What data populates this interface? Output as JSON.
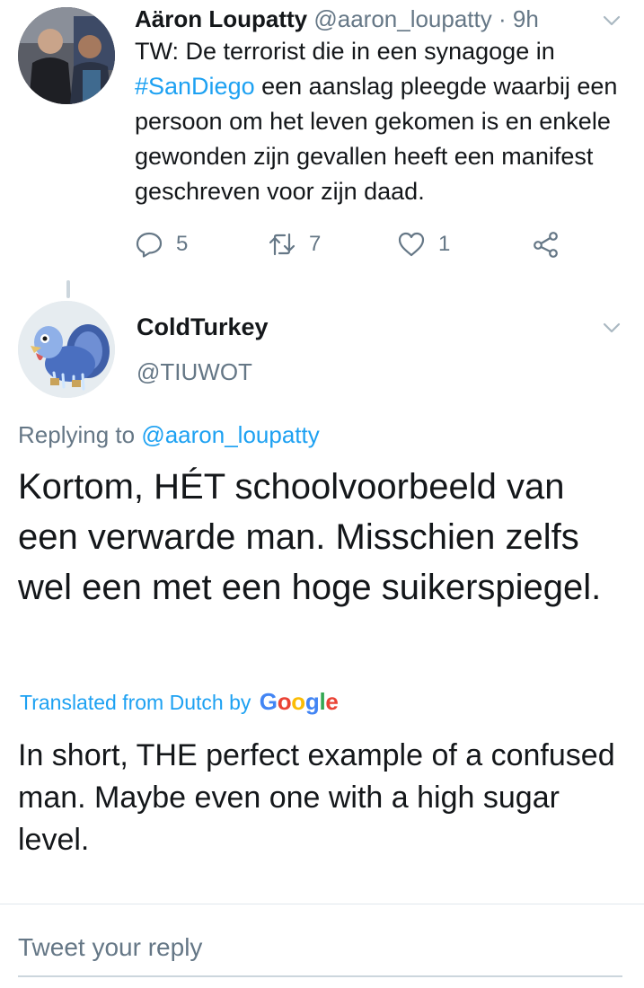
{
  "tweet": {
    "author_name": "Aäron Loupatty",
    "author_handle": "@aaron_loupatty",
    "time": "· 9h",
    "text_before": "TW: De terrorist die in een synagoge in ",
    "hashtag": "#SanDiego",
    "text_after": " een aanslag pleegde waarbij een persoon om het leven gekomen is en enkele gewonden zijn gevallen heeft een manifest geschreven voor zijn daad.",
    "replies": "5",
    "retweets": "7",
    "likes": "1"
  },
  "reply": {
    "author_name": "ColdTurkey",
    "author_handle": "@TIUWOT",
    "replying_label": "Replying to",
    "replying_to": "@aaron_loupatty",
    "text": "Kortom, HÉT schoolvoorbeeld van een verwarde man. Misschien zelfs wel een met een hoge suikerspiegel.",
    "translated_label": "Translated from Dutch by",
    "google_letters": [
      "G",
      "o",
      "o",
      "g",
      "l",
      "e"
    ],
    "translation": "In short, THE perfect example of a confused man. Maybe even one with a high sugar level."
  },
  "composer": {
    "placeholder": "Tweet your reply"
  },
  "colors": {
    "link": "#1da1f2",
    "secondary_text": "#657786",
    "primary_text": "#14171a",
    "google_blue": "#4285f4",
    "google_red": "#ea4335",
    "google_yellow": "#fbbc05",
    "google_green": "#34a853"
  },
  "icons": [
    "chevron-down-icon",
    "reply-icon",
    "retweet-icon",
    "like-icon",
    "share-icon"
  ]
}
